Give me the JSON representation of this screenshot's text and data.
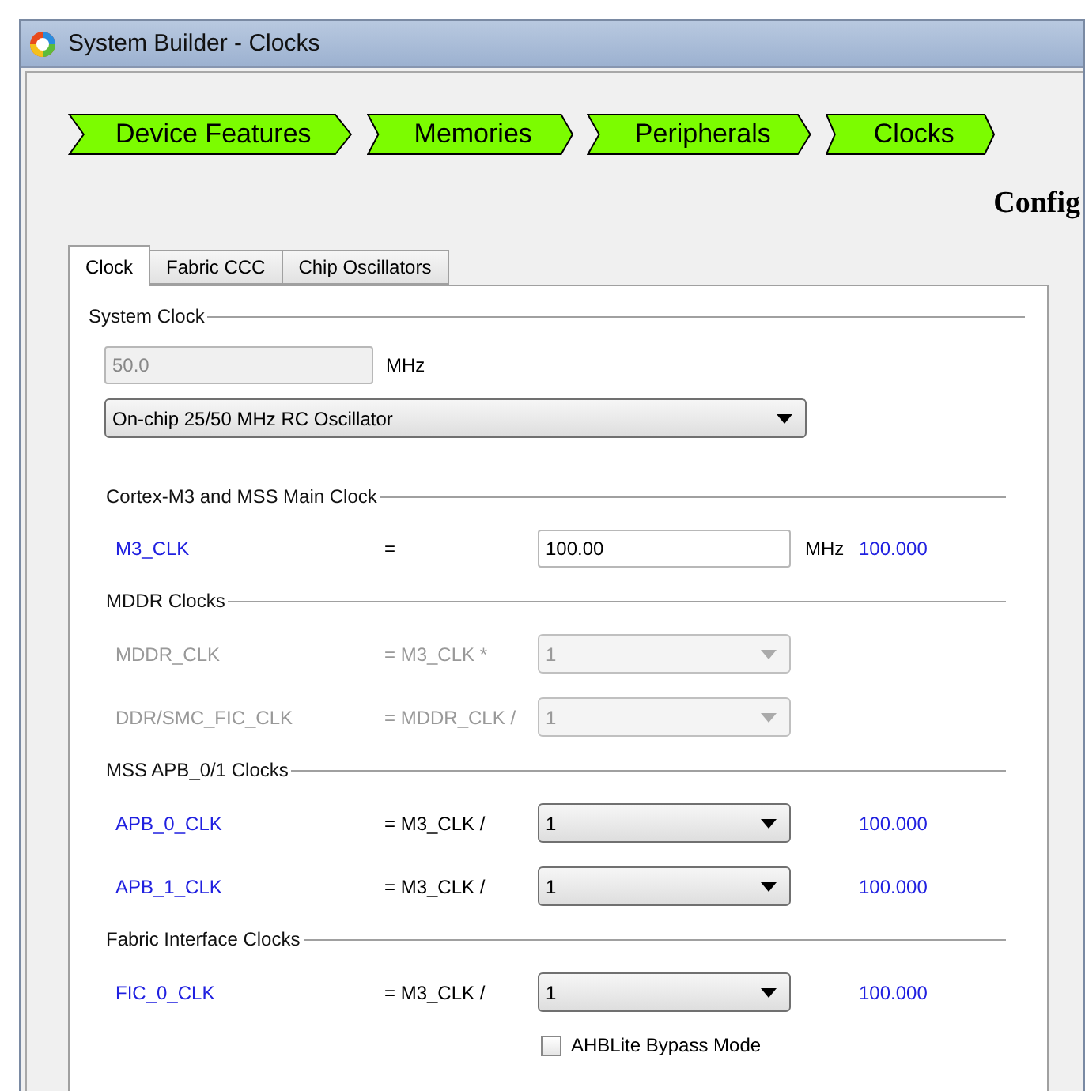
{
  "window": {
    "title": "System Builder - Clocks"
  },
  "steps": [
    {
      "label": "Device Features"
    },
    {
      "label": "Memories"
    },
    {
      "label": "Peripherals"
    },
    {
      "label": "Clocks"
    }
  ],
  "heading": "Config",
  "tabs": [
    {
      "label": "Clock",
      "selected": true
    },
    {
      "label": "Fabric CCC",
      "selected": false
    },
    {
      "label": "Chip Oscillators",
      "selected": false
    }
  ],
  "system_clock": {
    "title": "System Clock",
    "frequency": {
      "value": "50.0",
      "disabled": true
    },
    "unit": "MHz",
    "source": {
      "value": "On-chip 25/50 MHz RC Oscillator"
    }
  },
  "sections": [
    {
      "title": "Cortex-M3 and MSS Main Clock",
      "rows": [
        {
          "name": "M3_CLK",
          "expr": "=",
          "kind": "input",
          "value": "100.00",
          "unit": "MHz",
          "result": "100.000",
          "disabled": false
        }
      ]
    },
    {
      "title": "MDDR Clocks",
      "rows": [
        {
          "name": "MDDR_CLK",
          "expr": "= M3_CLK *",
          "kind": "select",
          "value": "1",
          "disabled": true
        },
        {
          "name": "DDR/SMC_FIC_CLK",
          "expr": "= MDDR_CLK /",
          "kind": "select",
          "value": "1",
          "disabled": true
        }
      ]
    },
    {
      "title": "MSS APB_0/1 Clocks",
      "rows": [
        {
          "name": "APB_0_CLK",
          "expr": "= M3_CLK /",
          "kind": "select",
          "value": "1",
          "result": "100.000",
          "disabled": false
        },
        {
          "name": "APB_1_CLK",
          "expr": "= M3_CLK /",
          "kind": "select",
          "value": "1",
          "result": "100.000",
          "disabled": false
        }
      ]
    },
    {
      "title": "Fabric Interface Clocks",
      "rows": [
        {
          "name": "FIC_0_CLK",
          "expr": "= M3_CLK /",
          "kind": "select",
          "value": "1",
          "result": "100.000",
          "disabled": false
        }
      ]
    }
  ],
  "bypass": {
    "label": "AHBLite Bypass Mode",
    "checked": false
  }
}
